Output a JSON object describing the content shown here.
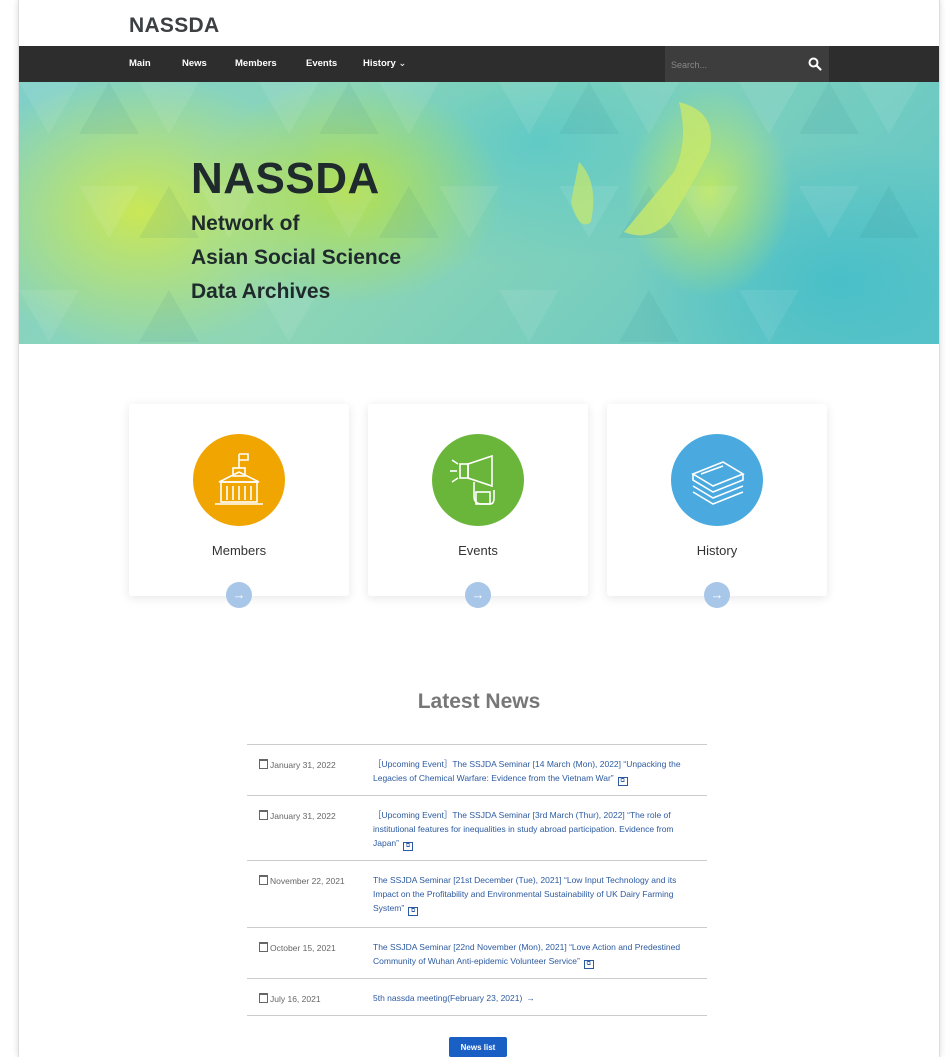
{
  "brand": "NASSDA",
  "nav": {
    "items": [
      "Main",
      "News",
      "Members",
      "Events",
      "History"
    ],
    "history_caret": "⌄",
    "search_placeholder": "Search..."
  },
  "hero": {
    "title": "NASSDA",
    "subtitle_lines": [
      "Network of",
      "Asian Social Science",
      "Data Archives"
    ]
  },
  "cards": [
    {
      "label": "Members",
      "color": "#f0a500",
      "icon": "building-icon"
    },
    {
      "label": "Events",
      "color": "#6ab63a",
      "icon": "megaphone-icon"
    },
    {
      "label": "History",
      "color": "#4aaae0",
      "icon": "books-icon"
    }
  ],
  "card_arrow": "→",
  "news": {
    "heading": "Latest News",
    "items": [
      {
        "date": "January 31, 2022",
        "text": "［Upcoming Event］The SSJDA Seminar [14 March (Mon), 2022] “Unpacking the Legacies of Chemical Warfare: Evidence from the Vietnam War”",
        "icon": "external-link-icon"
      },
      {
        "date": "January 31, 2022",
        "text": "［Upcoming Event］The SSJDA Seminar [3rd March (Thur), 2022] “The role of institutional features for inequalities in study abroad participation. Evidence from Japan”",
        "icon": "external-link-icon"
      },
      {
        "date": "November 22, 2021",
        "text": "The SSJDA Seminar [21st December (Tue), 2021] “Low Input Technology and its Impact on the Profitability and Environmental Sustainability of UK Dairy Farming System”",
        "icon": "external-link-icon"
      },
      {
        "date": "October 15, 2021",
        "text": "The SSJDA Seminar [22nd November (Mon), 2021] “Love Action and Predestined Community of Wuhan Anti-epidemic Volunteer Service”",
        "icon": "external-link-icon"
      },
      {
        "date": "July 16, 2021",
        "text": "5th nassda meeting(February 23, 2021)",
        "icon": "arrow-right-icon",
        "arrow": "→"
      }
    ],
    "button": "News list"
  }
}
